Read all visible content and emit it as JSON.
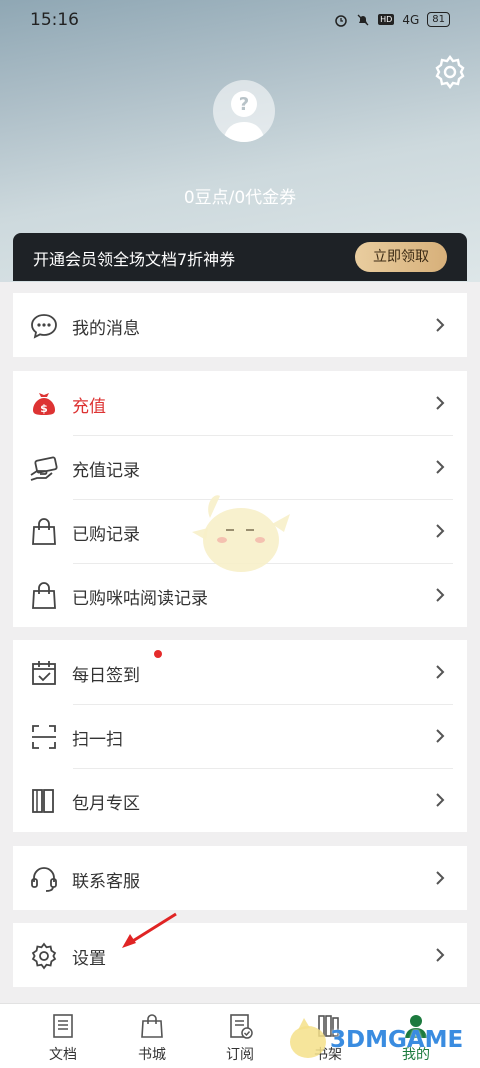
{
  "status_bar": {
    "time": "15:16",
    "network": "4G",
    "battery": "81"
  },
  "header": {
    "points_text": "0豆点/0代金券"
  },
  "vip_banner": {
    "text": "开通会员领全场文档7折神券",
    "button_label": "立即领取"
  },
  "menu_groups": [
    {
      "items": [
        {
          "icon": "message-bubble-icon",
          "label": "我的消息"
        }
      ]
    },
    {
      "items": [
        {
          "icon": "money-bag-icon",
          "label": "充值",
          "color": "#d33333"
        },
        {
          "icon": "card-hand-icon",
          "label": "充值记录"
        },
        {
          "icon": "shopping-bag-icon",
          "label": "已购记录"
        },
        {
          "icon": "shopping-bag-icon",
          "label": "已购咪咕阅读记录"
        }
      ]
    },
    {
      "items": [
        {
          "icon": "calendar-check-icon",
          "label": "每日签到",
          "badge": "red-dot"
        },
        {
          "icon": "scan-icon",
          "label": "扫一扫"
        },
        {
          "icon": "book-stack-icon",
          "label": "包月专区"
        }
      ]
    },
    {
      "items": [
        {
          "icon": "headset-icon",
          "label": "联系客服"
        }
      ]
    },
    {
      "items": [
        {
          "icon": "gear-icon",
          "label": "设置"
        }
      ]
    }
  ],
  "tabs": [
    {
      "label": "文档",
      "icon": "document-icon",
      "active": false
    },
    {
      "label": "书城",
      "icon": "bag-icon",
      "active": false
    },
    {
      "label": "订阅",
      "icon": "subscribe-icon",
      "active": false
    },
    {
      "label": "书架",
      "icon": "bookshelf-icon",
      "active": false
    },
    {
      "label": "我的",
      "icon": "user-icon",
      "active": true,
      "color": "#1c7a3e"
    }
  ],
  "watermark": {
    "text": "3DMGAME"
  }
}
